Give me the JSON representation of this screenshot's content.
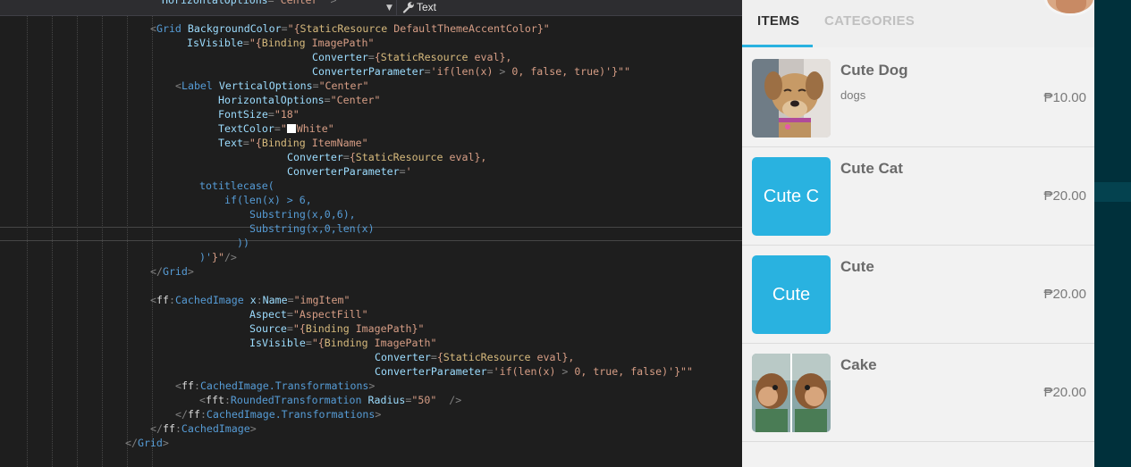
{
  "toolbar": {
    "property_label": "Text",
    "icons": {
      "dropdown": "chevron-down-icon",
      "wrench": "wrench-icon"
    }
  },
  "code": [
    [
      "HorizontalOptions=\"Center\" >"
    ],
    [],
    [
      "<Grid BackgroundColor=\"{StaticResource DefaultThemeAccentColor}\""
    ],
    [
      "IsVisible=\"{Binding ImagePath,"
    ],
    [
      "Converter={StaticResource eval},"
    ],
    [
      "ConverterParameter='if(len(x) > 0, false, true)'}\">"
    ],
    [
      "<Label VerticalOptions=\"Center\""
    ],
    [
      "HorizontalOptions=\"Center\""
    ],
    [
      "FontSize=\"18\""
    ],
    [
      "TextColor=\"White\""
    ],
    [
      "Text=\"{Binding ItemName,"
    ],
    [
      "Converter={StaticResource eval},"
    ],
    [
      "ConverterParameter='"
    ],
    [
      "totitlecase("
    ],
    [
      "if(len(x) > 6,"
    ],
    [
      "Substring(x,0,6),"
    ],
    [
      "Substring(x,0,len(x)"
    ],
    [
      "))"
    ],
    [
      ")'}\"/>"
    ],
    [
      "</Grid>"
    ],
    [],
    [
      "<ff:CachedImage x:Name=\"imgItem\""
    ],
    [
      "Aspect=\"AspectFill\""
    ],
    [
      "Source=\"{Binding ImagePath}\""
    ],
    [
      "IsVisible=\"{Binding ImagePath,"
    ],
    [
      "Converter={StaticResource eval},"
    ],
    [
      "ConverterParameter='if(len(x) > 0, true, false)'}\">"
    ],
    [
      "<ff:CachedImage.Transformations>"
    ],
    [
      "<fft:RoundedTransformation Radius=\"50\"  />"
    ],
    [
      "</ff:CachedImage.Transformations>"
    ],
    [
      "</ff:CachedImage>"
    ],
    [
      "</Grid>"
    ]
  ],
  "app": {
    "tabs": [
      {
        "label": "ITEMS",
        "active": true
      },
      {
        "label": "CATEGORIES",
        "active": false
      }
    ],
    "accent_color": "#29b2e0",
    "items": [
      {
        "name": "Cute Dog",
        "category": "dogs",
        "price": "₱10.00",
        "thumb_type": "photo-dog"
      },
      {
        "name": "Cute Cat",
        "category": "",
        "price": "₱20.00",
        "thumb_type": "text",
        "thumb_text": "Cute C"
      },
      {
        "name": "Cute",
        "category": "",
        "price": "₱20.00",
        "thumb_type": "text",
        "thumb_text": "Cute"
      },
      {
        "name": "Cake",
        "category": "",
        "price": "₱20.00",
        "thumb_type": "photo-monkey"
      }
    ]
  }
}
